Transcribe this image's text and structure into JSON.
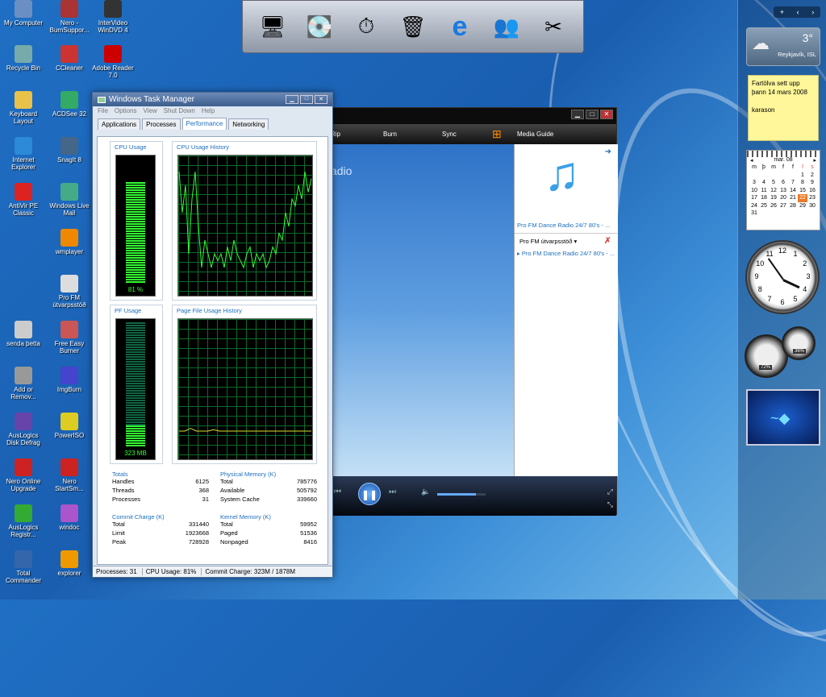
{
  "desktop": {
    "icons": [
      {
        "label": "My Computer",
        "icon": "computer-icon",
        "color": "#6b8fc4"
      },
      {
        "label": "Nero - BurnSuppor...",
        "icon": "nero-icon",
        "color": "#a33"
      },
      {
        "label": "InterVideo WinDVD 4",
        "icon": "dvd-icon",
        "color": "#333"
      },
      {
        "label": "Recycle Bin",
        "icon": "recycle-bin-icon",
        "color": "#7aa"
      },
      {
        "label": "CCleaner",
        "icon": "ccleaner-icon",
        "color": "#c33"
      },
      {
        "label": "Adobe Reader 7.0",
        "icon": "pdf-icon",
        "color": "#c00"
      },
      {
        "label": "Keyboard Layout",
        "icon": "folder-icon",
        "color": "#e8c14a"
      },
      {
        "label": "ACDSee 32",
        "icon": "acdsee-icon",
        "color": "#3a6"
      },
      {
        "label": "Internet Explorer",
        "icon": "ie-icon",
        "color": "#2c8ad8"
      },
      {
        "label": "SnagIt 8",
        "icon": "snagit-icon",
        "color": "#468"
      },
      {
        "label": "AntiVir PE Classic",
        "icon": "antivir-icon",
        "color": "#d22"
      },
      {
        "label": "Windows Live Mail",
        "icon": "mail-icon",
        "color": "#4a8"
      },
      {
        "label": "wmplayer",
        "icon": "media-player-icon",
        "color": "#e80"
      },
      {
        "label": "Pro FM útvarpsstöð",
        "icon": "document-icon",
        "color": "#ddd"
      },
      {
        "label": "senda þetta",
        "icon": "file-icon",
        "color": "#ccc"
      },
      {
        "label": "Free Easy Burner",
        "icon": "burner-icon",
        "color": "#c55"
      },
      {
        "label": "Add or Remov...",
        "icon": "add-remove-icon",
        "color": "#999"
      },
      {
        "label": "ImgBurn",
        "icon": "imgburn-icon",
        "color": "#44c"
      },
      {
        "label": "AusLogics Disk Defrag",
        "icon": "defrag-icon",
        "color": "#64a"
      },
      {
        "label": "PowerISO",
        "icon": "poweriso-icon",
        "color": "#dc2"
      },
      {
        "label": "Nero Online Upgrade",
        "icon": "nero-upgrade-icon",
        "color": "#c22"
      },
      {
        "label": "Nero StartSm...",
        "icon": "nero-start-icon",
        "color": "#c22"
      },
      {
        "label": "AusLogics Registr...",
        "icon": "registry-icon",
        "color": "#3a3"
      },
      {
        "label": "windoc",
        "icon": "windoc-icon",
        "color": "#a5c"
      },
      {
        "label": "Total Commander",
        "icon": "floppy-icon",
        "color": "#36a"
      },
      {
        "label": "explorer",
        "icon": "explorer-icon",
        "color": "#e90"
      }
    ]
  },
  "dock": {
    "items": [
      {
        "icon": "monitor-icon",
        "glyph": "🖥"
      },
      {
        "icon": "drive-icon",
        "glyph": "💽"
      },
      {
        "icon": "gauge-icon",
        "glyph": "⏱"
      },
      {
        "icon": "trash-icon",
        "glyph": "🗑"
      },
      {
        "icon": "ie-icon",
        "glyph": "e"
      },
      {
        "icon": "messenger-icon",
        "glyph": "👥"
      },
      {
        "icon": "tools-icon",
        "glyph": "✂"
      }
    ]
  },
  "taskmgr": {
    "title": "Windows Task Manager",
    "menu": [
      "File",
      "Options",
      "View",
      "Shut Down",
      "Help"
    ],
    "tabs": [
      "Applications",
      "Processes",
      "Performance",
      "Networking"
    ],
    "cpu_usage_label": "CPU Usage",
    "cpu_usage_value": "81 %",
    "cpu_usage_fraction": 0.81,
    "cpu_history_label": "CPU Usage History",
    "pf_usage_label": "PF Usage",
    "pf_usage_value": "323 MB",
    "pf_usage_fraction": 0.17,
    "pf_history_label": "Page File Usage History",
    "totals": {
      "title": "Totals",
      "rows": [
        [
          "Handles",
          "6125"
        ],
        [
          "Threads",
          "368"
        ],
        [
          "Processes",
          "31"
        ]
      ]
    },
    "physical": {
      "title": "Physical Memory (K)",
      "rows": [
        [
          "Total",
          "785776"
        ],
        [
          "Available",
          "505792"
        ],
        [
          "System Cache",
          "339660"
        ]
      ]
    },
    "commit": {
      "title": "Commit Charge (K)",
      "rows": [
        [
          "Total",
          "331440"
        ],
        [
          "Limit",
          "1923668"
        ],
        [
          "Peak",
          "728928"
        ]
      ]
    },
    "kernel": {
      "title": "Kernel Memory (K)",
      "rows": [
        [
          "Total",
          "59952"
        ],
        [
          "Paged",
          "51536"
        ],
        [
          "Nonpaged",
          "8416"
        ]
      ]
    },
    "status": {
      "processes": "Processes: 31",
      "cpu": "CPU Usage: 81%",
      "commit": "Commit Charge: 323M / 1878M"
    },
    "cpu_history": [
      0.9,
      0.6,
      0.8,
      0.3,
      0.7,
      0.9,
      0.5,
      0.2,
      0.4,
      0.3,
      0.2,
      0.3,
      0.25,
      0.3,
      0.2,
      0.35,
      0.25,
      0.4,
      0.3,
      0.25,
      0.2,
      0.3,
      0.35,
      0.2,
      0.3,
      0.25,
      0.3,
      0.2,
      0.25,
      0.35,
      0.3,
      0.45,
      0.4,
      0.6,
      0.5,
      0.7,
      0.65,
      0.8,
      0.7,
      0.9,
      0.75,
      0.85
    ],
    "pf_history": [
      0.2,
      0.2,
      0.22,
      0.2,
      0.2,
      0.2,
      0.21,
      0.2,
      0.2,
      0.2,
      0.2,
      0.2,
      0.2,
      0.2,
      0.2,
      0.2,
      0.2,
      0.2,
      0.2,
      0.2,
      0.2,
      0.2,
      0.2,
      0.2
    ]
  },
  "wmp": {
    "nav": [
      "Rip",
      "Burn",
      "Sync",
      "Media Guide"
    ],
    "video_text": "adio",
    "station_title": "Pro FM Dance Radio 24/7 80's - ...",
    "playlist_name": "Pro FM útvarpsstöð",
    "playlist_item": "Pro FM Dance Radio 24/7 80's - ...",
    "volume_fraction": 0.8
  },
  "sidebar": {
    "weather_temp": "3°",
    "weather_city": "Reykjavík, ISL",
    "note_lines": [
      "Fartölva sett upp",
      "þann 14 mars 2008",
      "",
      "karason"
    ],
    "calendar_month": "mar. 08",
    "calendar_days_header": [
      "m",
      "þ",
      "m",
      "f",
      "f",
      "l",
      "s"
    ],
    "calendar_rows": [
      [
        "",
        "",
        "",
        "",
        "",
        "1",
        "2"
      ],
      [
        "3",
        "4",
        "5",
        "6",
        "7",
        "8",
        "9"
      ],
      [
        "10",
        "11",
        "12",
        "13",
        "14",
        "15",
        "16"
      ],
      [
        "17",
        "18",
        "19",
        "20",
        "21",
        "22",
        "23"
      ],
      [
        "24",
        "25",
        "26",
        "27",
        "28",
        "29",
        "30"
      ],
      [
        "31",
        "",
        "",
        "",
        "",
        "",
        ""
      ]
    ],
    "calendar_today": "22",
    "clock_numbers": [
      "12",
      "1",
      "2",
      "3",
      "4",
      "5",
      "6",
      "7",
      "8",
      "9",
      "10",
      "11"
    ],
    "meter1": "72%",
    "meter2": "36%"
  }
}
